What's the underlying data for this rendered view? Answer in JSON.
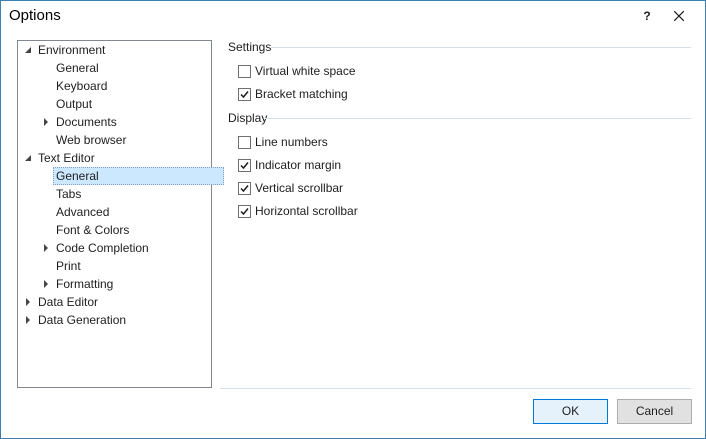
{
  "window": {
    "title": "Options",
    "help_label": "?"
  },
  "tree": {
    "nodes": [
      {
        "label": "Environment",
        "expander": "expanded"
      },
      {
        "label": "General"
      },
      {
        "label": "Keyboard"
      },
      {
        "label": "Output"
      },
      {
        "label": "Documents",
        "expander": "collapsed"
      },
      {
        "label": "Web browser"
      },
      {
        "label": "Text Editor",
        "expander": "expanded"
      },
      {
        "label": "General",
        "selected": true
      },
      {
        "label": "Tabs"
      },
      {
        "label": "Advanced"
      },
      {
        "label": "Font & Colors"
      },
      {
        "label": "Code Completion",
        "expander": "collapsed"
      },
      {
        "label": "Print"
      },
      {
        "label": "Formatting",
        "expander": "collapsed"
      },
      {
        "label": "Data Editor",
        "expander": "collapsed"
      },
      {
        "label": "Data Generation",
        "expander": "collapsed"
      }
    ]
  },
  "settings": {
    "title": "Settings",
    "options": [
      {
        "label": "Virtual white space",
        "checked": false
      },
      {
        "label": "Bracket matching",
        "checked": true
      }
    ]
  },
  "display": {
    "title": "Display",
    "options": [
      {
        "label": "Line numbers",
        "checked": false
      },
      {
        "label": "Indicator margin",
        "checked": true
      },
      {
        "label": "Vertical scrollbar",
        "checked": true
      },
      {
        "label": "Horizontal scrollbar",
        "checked": true
      }
    ]
  },
  "buttons": {
    "ok": "OK",
    "cancel": "Cancel"
  },
  "colors": {
    "accent": "#0078d7",
    "selection": "#cce8ff",
    "border": "#3c7fb1"
  }
}
